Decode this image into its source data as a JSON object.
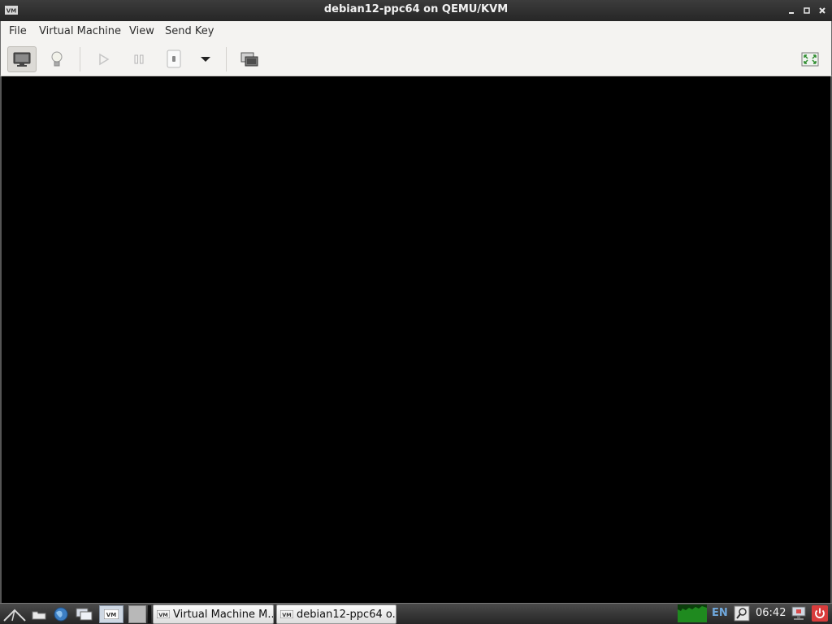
{
  "window": {
    "title": "debian12-ppc64 on QEMU/KVM"
  },
  "menubar": {
    "items": [
      "File",
      "Virtual Machine",
      "View",
      "Send Key"
    ]
  },
  "toolbar": {
    "buttons": [
      {
        "name": "console",
        "icon": "monitor-icon",
        "active": true
      },
      {
        "name": "details",
        "icon": "lightbulb-icon",
        "active": false
      },
      {
        "name": "run",
        "icon": "play-icon",
        "enabled": false
      },
      {
        "name": "pause",
        "icon": "pause-icon",
        "enabled": false
      },
      {
        "name": "shutdown",
        "icon": "power-switch-icon",
        "enabled": true
      },
      {
        "name": "shutdown-menu",
        "icon": "dropdown-arrow-icon",
        "enabled": true
      },
      {
        "name": "snapshots",
        "icon": "snapshots-icon",
        "enabled": true
      },
      {
        "name": "fullscreen",
        "icon": "fullscreen-icon",
        "enabled": true
      }
    ]
  },
  "taskbar": {
    "launchers": [
      "menu-icon",
      "folder-icon",
      "browser-globe-icon",
      "show-desktop-icon",
      "virt-manager-icon"
    ],
    "tasks": [
      {
        "label": "Virtual Machine M...",
        "icon": "vm-icon"
      },
      {
        "label": "debian12-ppc64 o...",
        "icon": "vm-icon"
      }
    ],
    "tray": {
      "language": "EN",
      "time": "06:42",
      "icons": [
        "cpu-monitor-icon",
        "search-icon",
        "network-icon",
        "power-icon"
      ]
    }
  },
  "colors": {
    "titlebar": "#2e2e2e",
    "display": "#000000",
    "menubar": "#f4f3f1",
    "cpu_graph": "#1f8a1f",
    "power": "#e53b3b"
  }
}
